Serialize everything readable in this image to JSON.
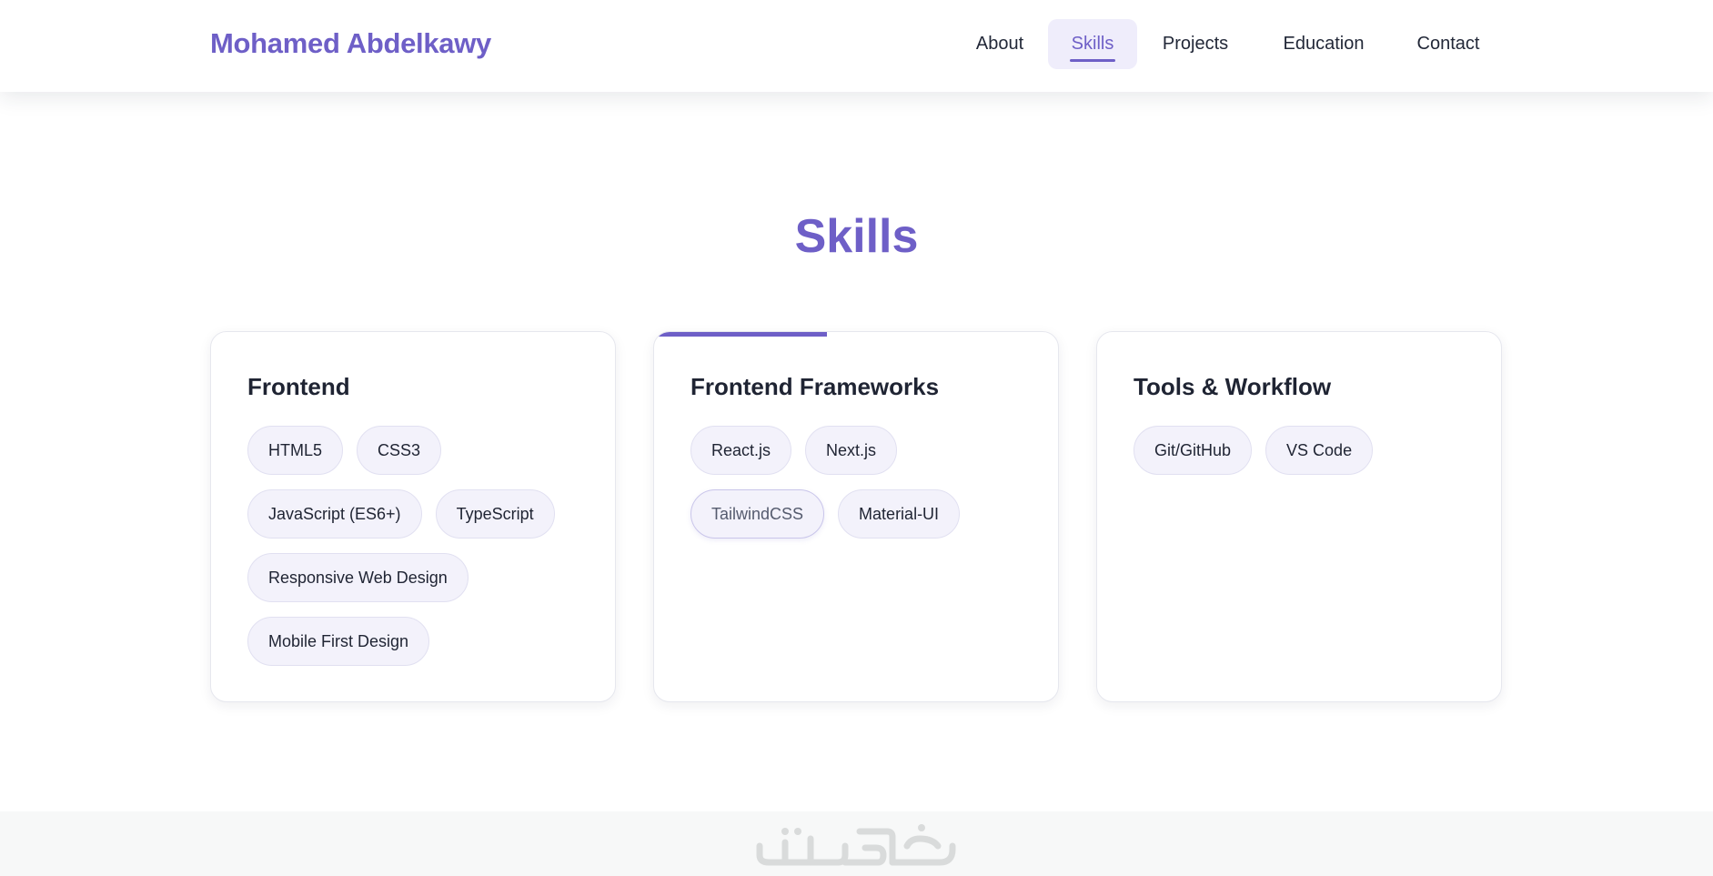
{
  "header": {
    "brand": "Mohamed Abdelkawy",
    "nav": [
      {
        "label": "About"
      },
      {
        "label": "Skills",
        "active": true
      },
      {
        "label": "Projects"
      },
      {
        "label": "Education"
      },
      {
        "label": "Contact"
      }
    ]
  },
  "skills": {
    "title": "Skills",
    "cards": [
      {
        "title": "Frontend",
        "tags": [
          "HTML5",
          "CSS3",
          "JavaScript (ES6+)",
          "TypeScript",
          "Responsive Web Design",
          "Mobile First Design"
        ]
      },
      {
        "title": "Frontend Frameworks",
        "tags": [
          "React.js",
          "Next.js",
          "TailwindCSS",
          "Material-UI"
        ]
      },
      {
        "title": "Tools & Workflow",
        "tags": [
          "Git/GitHub",
          "VS Code"
        ]
      }
    ]
  },
  "footer": {
    "logo_icon": "watermark-logo-icon"
  },
  "colors": {
    "accent": "#6e5fc7",
    "text": "#1f2433",
    "tag_bg": "#f3f2fb",
    "footer_bg": "#f7f8f8"
  }
}
